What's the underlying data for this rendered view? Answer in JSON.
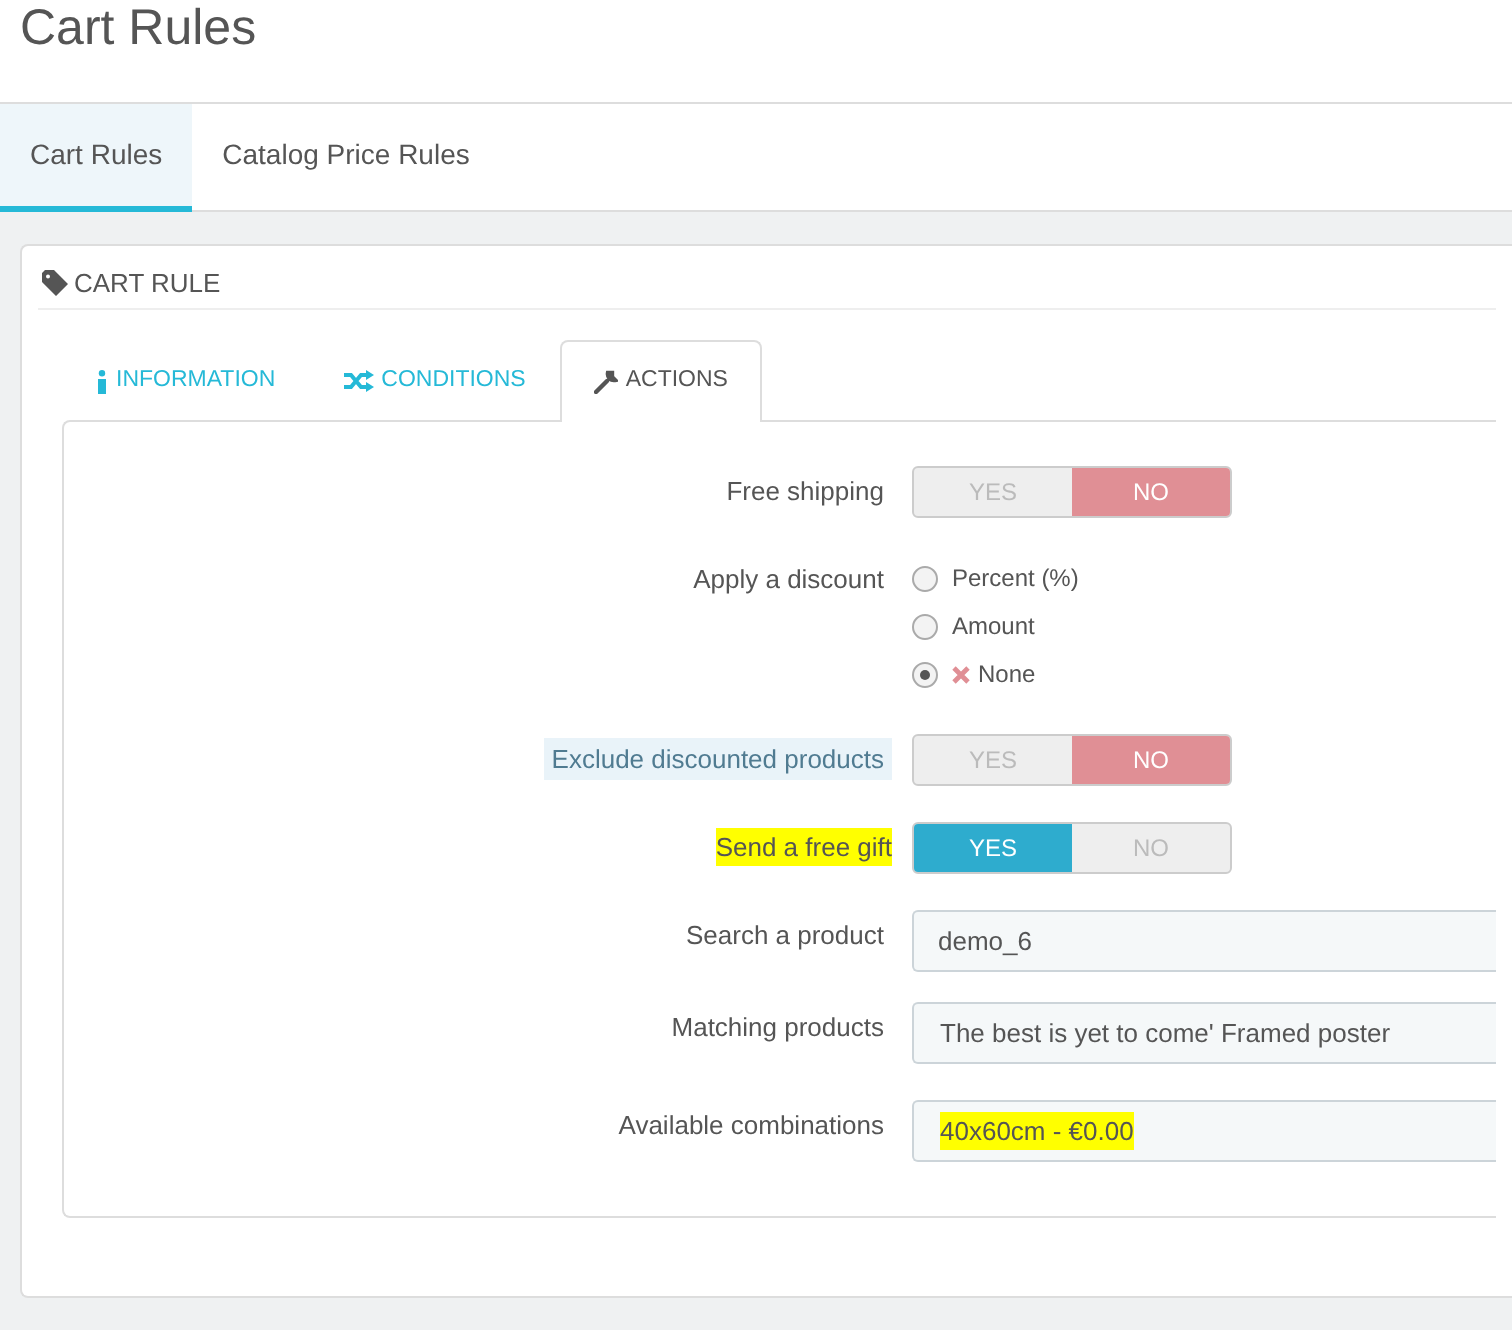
{
  "page_title": "Cart Rules",
  "page_tabs": [
    {
      "label": "Cart Rules",
      "selected": true
    },
    {
      "label": "Catalog Price Rules",
      "selected": false
    }
  ],
  "panel": {
    "title": "CART RULE",
    "tabs": [
      {
        "label": "INFORMATION",
        "selected": false
      },
      {
        "label": "CONDITIONS",
        "selected": false
      },
      {
        "label": "ACTIONS",
        "selected": true
      }
    ],
    "fields": [
      {
        "kind": "toggle",
        "label": "Free shipping",
        "boxed": false,
        "highlighted": false,
        "yes": "YES",
        "no": "NO",
        "on": false
      },
      {
        "kind": "radio",
        "label": "Apply a discount",
        "boxed": false,
        "highlighted": false,
        "options": [
          {
            "label": "Percent (%)",
            "selected": false,
            "cross": false
          },
          {
            "label": "Amount",
            "selected": false,
            "cross": false
          },
          {
            "label": "None",
            "selected": true,
            "cross": true
          }
        ]
      },
      {
        "kind": "toggle",
        "label": "Exclude discounted products",
        "boxed": true,
        "highlighted": false,
        "yes": "YES",
        "no": "NO",
        "on": false
      },
      {
        "kind": "toggle",
        "label": "Send a free gift",
        "boxed": false,
        "highlighted": true,
        "yes": "YES",
        "no": "NO",
        "on": true
      },
      {
        "kind": "text",
        "label": "Search a product",
        "boxed": false,
        "highlighted": false,
        "value": "demo_6",
        "value_highlighted": false
      },
      {
        "kind": "select",
        "label": "Matching products",
        "boxed": false,
        "highlighted": false,
        "value": "The best is yet to come' Framed poster",
        "value_highlighted": false
      },
      {
        "kind": "select",
        "label": "Available combinations",
        "boxed": false,
        "highlighted": false,
        "value": "40x60cm - €0.00",
        "value_highlighted": true
      }
    ]
  }
}
